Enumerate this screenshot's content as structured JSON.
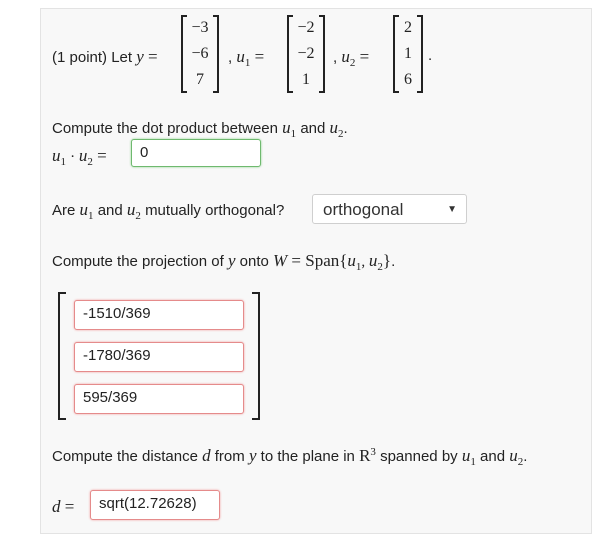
{
  "problem": {
    "intro": "(1 point) Let",
    "y_label": "y",
    "u1_label": "u",
    "sub1": "1",
    "sub2": "2",
    "u2_label": "u",
    "y_vector": [
      "−3",
      "−6",
      "7"
    ],
    "u1_vector": [
      "−2",
      "−2",
      "1"
    ],
    "u2_vector": [
      "2",
      "1",
      "6"
    ]
  },
  "q1": {
    "prompt_a": "Compute the dot product between",
    "and": "and",
    "answer": "0"
  },
  "q2": {
    "prompt_a": "Are",
    "and": "and",
    "prompt_b": "mutually orthogonal?",
    "selected": "orthogonal"
  },
  "q3": {
    "prompt_a": "Compute the projection of",
    "onto": "onto",
    "W": "W",
    "span": "Span",
    "answers": [
      "-1510/369",
      "-1780/369",
      "595/369"
    ]
  },
  "q4": {
    "prompt_a": "Compute the distance",
    "d": "d",
    "prompt_b": "from",
    "prompt_c": "to the plane in",
    "R": "R",
    "exp": "3",
    "prompt_d": "spanned by",
    "and": "and",
    "answer": "sqrt(12.72628)"
  },
  "colors": {
    "correct": "#6fb96f",
    "wrong": "#e58b8b"
  }
}
